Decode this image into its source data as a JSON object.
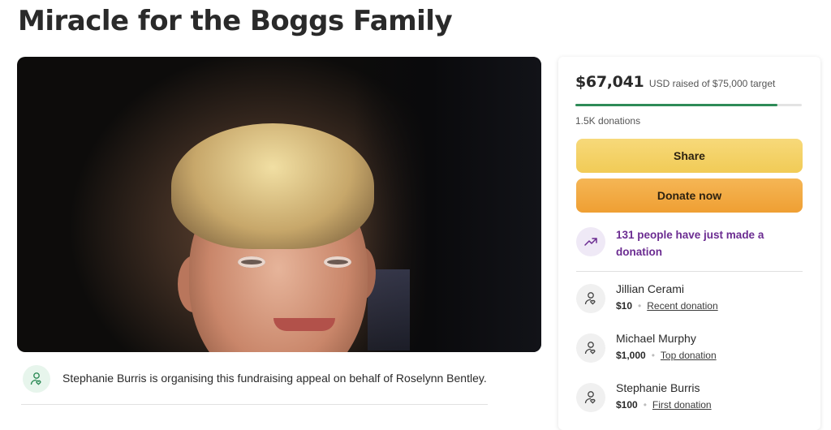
{
  "page": {
    "title": "Miracle for the Boggs Family"
  },
  "organiser": {
    "text": "Stephanie Burris is organising this fundraising appeal on behalf of Roselynn Bentley."
  },
  "fundraiser": {
    "amount": "$67,041",
    "raised_label": "USD raised of $75,000 target",
    "progress_fraction": 0.894,
    "donations_count": "1.5K donations",
    "share_label": "Share",
    "donate_label": "Donate now",
    "trend_text": "131 people have just made a donation"
  },
  "donors": [
    {
      "name": "Jillian Cerami",
      "amount": "$10",
      "tag": "Recent donation"
    },
    {
      "name": "Michael Murphy",
      "amount": "$1,000",
      "tag": "Top donation"
    },
    {
      "name": "Stephanie Burris",
      "amount": "$100",
      "tag": "First donation"
    }
  ],
  "colors": {
    "progress": "#2e8b57",
    "trend_text": "#6b2c91",
    "share_button": "#f1cb56",
    "donate_button": "#ef9f33"
  },
  "icons": {
    "organiser": "person-heart-icon",
    "trend": "trending-up-icon",
    "donor": "person-heart-icon"
  }
}
